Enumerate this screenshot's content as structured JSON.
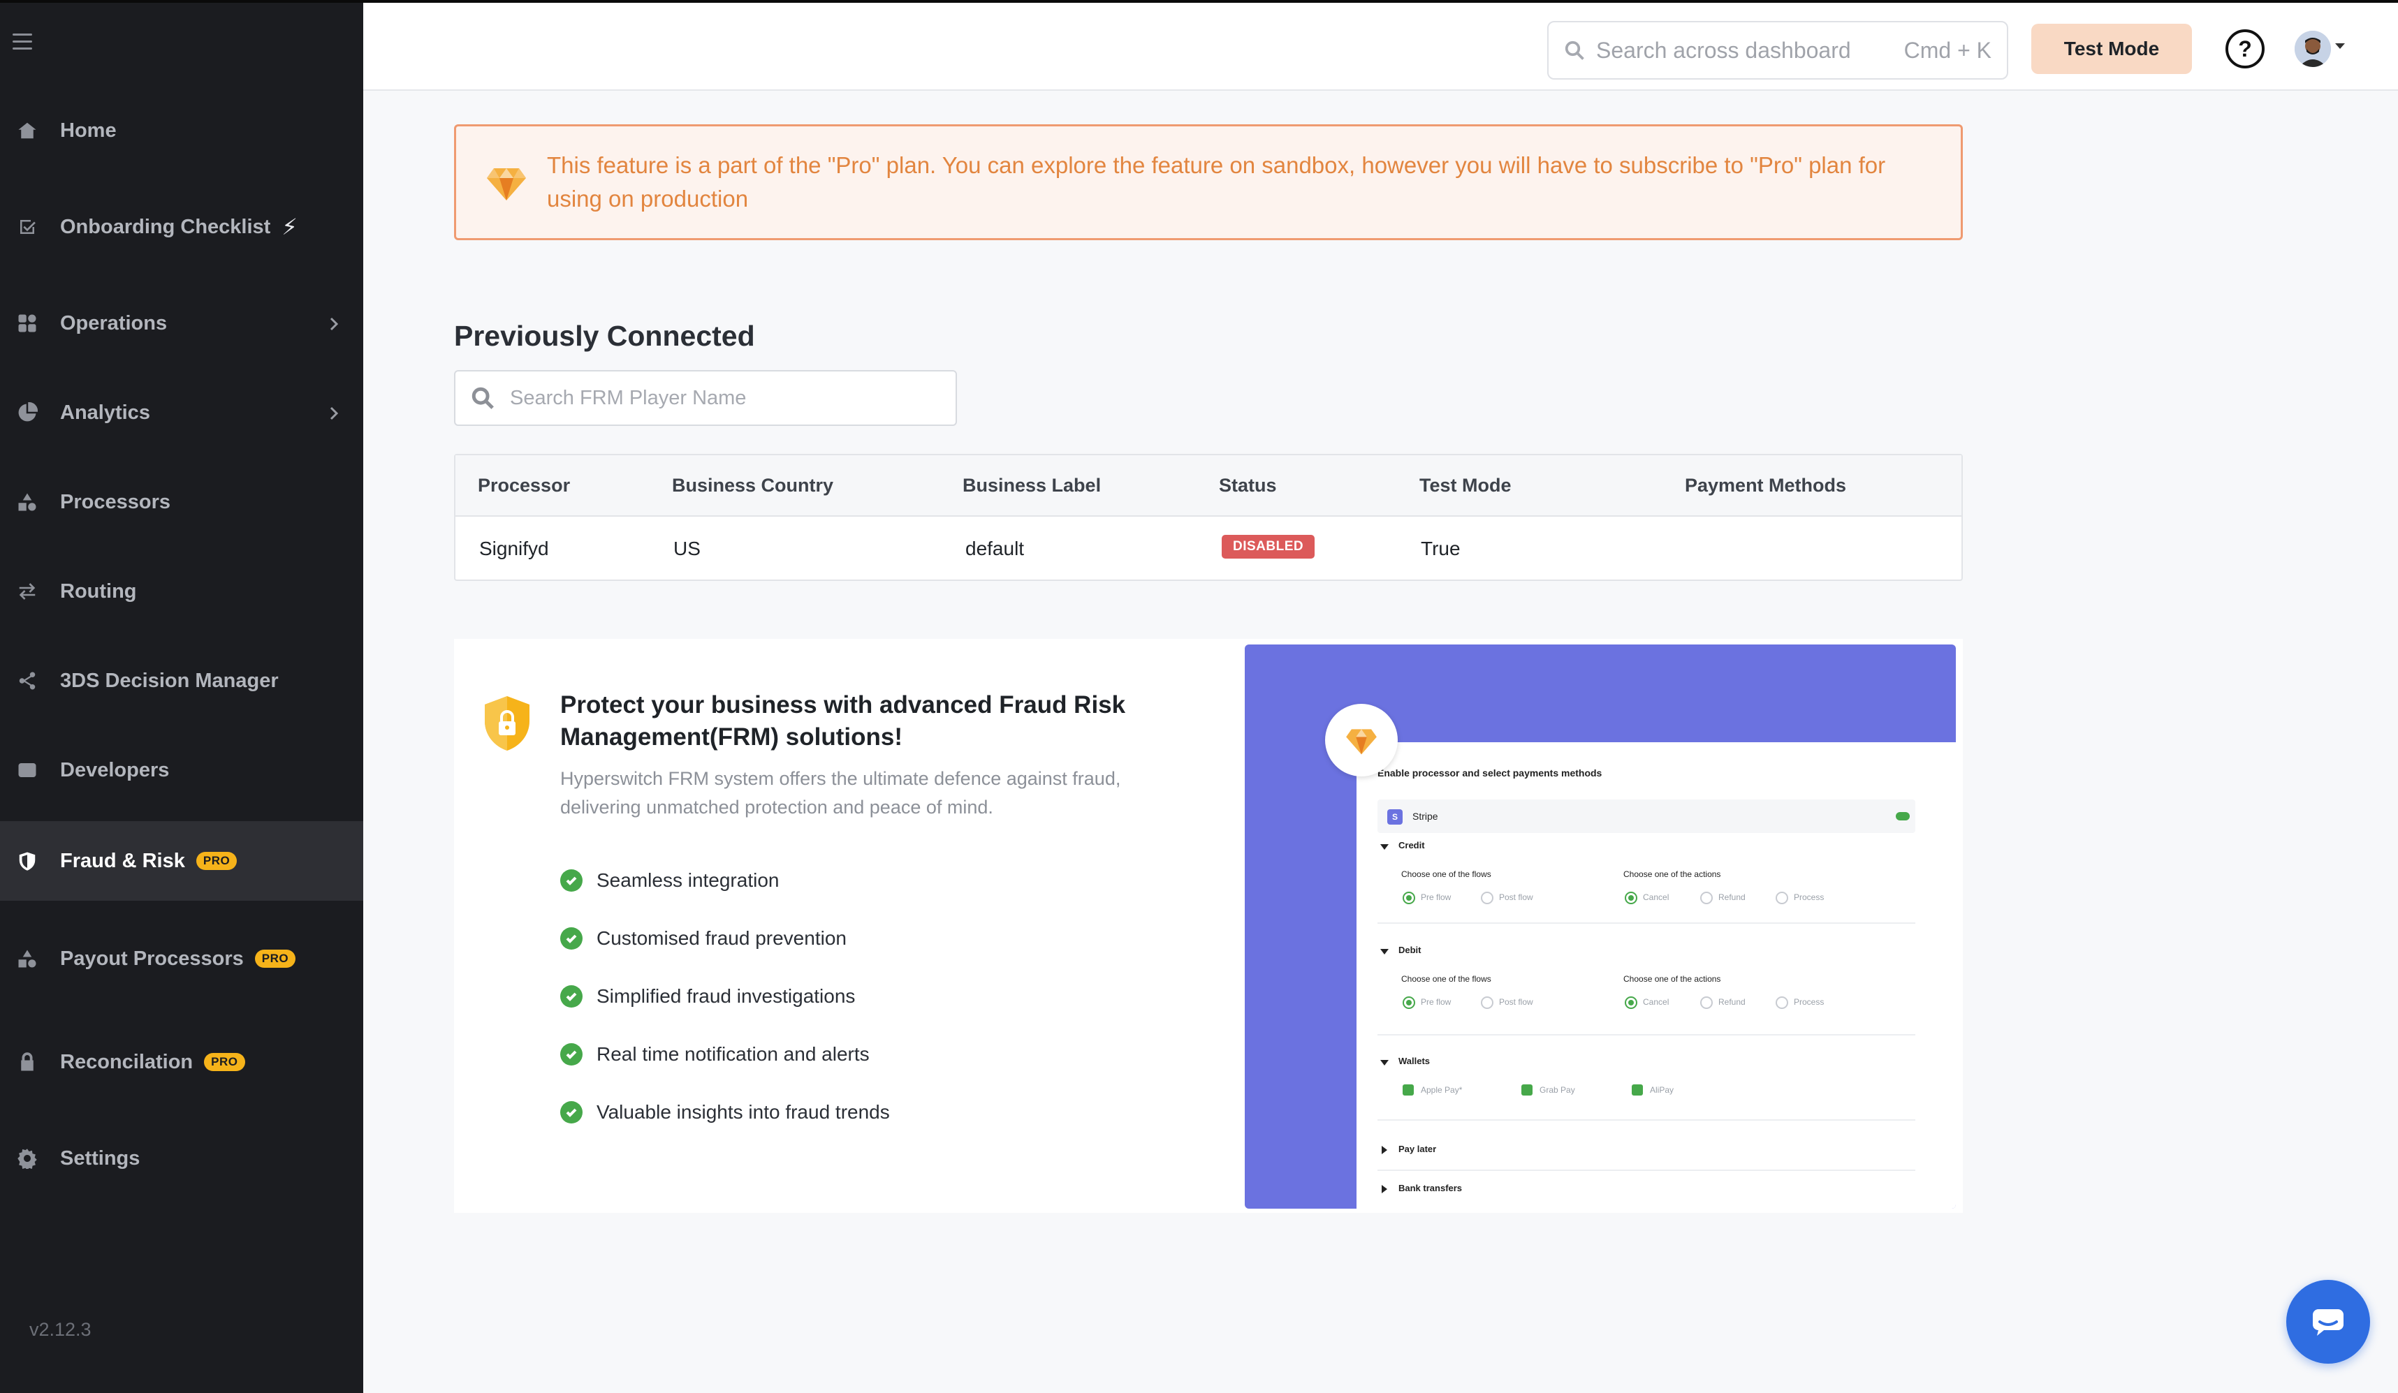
{
  "sidebar": {
    "items": [
      {
        "label": "Home",
        "icon": "home-icon"
      },
      {
        "label": "Onboarding Checklist",
        "icon": "checklist-icon"
      },
      {
        "label": "Operations",
        "icon": "operations-icon"
      },
      {
        "label": "Analytics",
        "icon": "analytics-icon"
      },
      {
        "label": "Processors",
        "icon": "processors-icon"
      },
      {
        "label": "Routing",
        "icon": "routing-icon"
      },
      {
        "label": "3DS Decision Manager",
        "icon": "share-icon"
      },
      {
        "label": "Developers",
        "icon": "developers-icon"
      },
      {
        "label": "Fraud & Risk",
        "icon": "shield-icon"
      },
      {
        "label": "Payout Processors",
        "icon": "processors-icon"
      },
      {
        "label": "Reconcilation",
        "icon": "lock-icon"
      },
      {
        "label": "Settings",
        "icon": "gear-icon"
      }
    ],
    "pro_label": "PRO",
    "version": "v2.12.3"
  },
  "header": {
    "search_placeholder": "Search across dashboard",
    "search_shortcut": "Cmd + K",
    "test_mode_label": "Test Mode",
    "help_label": "?"
  },
  "banner": {
    "text": "This feature is a part of the \"Pro\" plan. You can explore the feature on sandbox, however you will have to subscribe to \"Pro\" plan for using on production"
  },
  "previously_connected": {
    "title": "Previously Connected",
    "search_placeholder": "Search FRM Player Name",
    "columns": [
      "Processor",
      "Business Country",
      "Business Label",
      "Status",
      "Test Mode",
      "Payment Methods"
    ],
    "rows": [
      {
        "processor": "Signifyd",
        "country": "US",
        "label": "default",
        "status": "DISABLED",
        "test_mode": "True",
        "payment_methods": ""
      }
    ]
  },
  "promo": {
    "title": "Protect your business with advanced Fraud Risk Management(FRM) solutions!",
    "subtitle": "Hyperswitch FRM system offers the ultimate defence against fraud, delivering unmatched protection and peace of mind.",
    "features": [
      "Seamless integration",
      "Customised fraud prevention",
      "Simplified fraud investigations",
      "Real time notification and alerts",
      "Valuable insights into fraud trends"
    ],
    "preview": {
      "heading": "Enable processor and select payments methods",
      "processor": "Stripe",
      "credit": "Credit",
      "debit": "Debit",
      "flows_label": "Choose one of the flows",
      "actions_label": "Choose one of the actions",
      "pre_flow": "Pre flow",
      "post_flow": "Post flow",
      "cancel": "Cancel",
      "refund": "Refund",
      "process": "Process",
      "wallets": "Wallets",
      "apple_pay": "Apple Pay*",
      "grab_pay": "Grab Pay",
      "alipay": "AliPay",
      "pay_later": "Pay later",
      "bank_transfers": "Bank transfers"
    }
  },
  "colors": {
    "sidebar_bg": "#1b1c20",
    "accent_orange": "#e2853f",
    "pro_yellow": "#f6b31a",
    "disabled_red": "#dc5a5a",
    "preview_purple": "#6b72e0",
    "chat_blue": "#2f6de1"
  }
}
